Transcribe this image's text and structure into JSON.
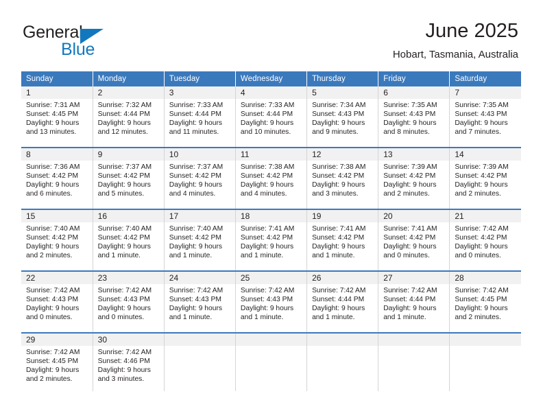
{
  "brand": {
    "name_top": "General",
    "name_bottom": "Blue",
    "triangle_color": "#1278be",
    "text_color": "#221f1f"
  },
  "header": {
    "title": "June 2025",
    "subtitle": "Hobart, Tasmania, Australia"
  },
  "theme": {
    "header_blue": "#3b79bd",
    "daynum_band": "#f1f1f1",
    "grid_line": "#d4d4d4",
    "text": "#231f20"
  },
  "weekdays": [
    "Sunday",
    "Monday",
    "Tuesday",
    "Wednesday",
    "Thursday",
    "Friday",
    "Saturday"
  ],
  "weeks": [
    [
      {
        "day": "1",
        "sunrise": "Sunrise: 7:31 AM",
        "sunset": "Sunset: 4:45 PM",
        "daylight_line1": "Daylight: 9 hours",
        "daylight_line2": "and 13 minutes."
      },
      {
        "day": "2",
        "sunrise": "Sunrise: 7:32 AM",
        "sunset": "Sunset: 4:44 PM",
        "daylight_line1": "Daylight: 9 hours",
        "daylight_line2": "and 12 minutes."
      },
      {
        "day": "3",
        "sunrise": "Sunrise: 7:33 AM",
        "sunset": "Sunset: 4:44 PM",
        "daylight_line1": "Daylight: 9 hours",
        "daylight_line2": "and 11 minutes."
      },
      {
        "day": "4",
        "sunrise": "Sunrise: 7:33 AM",
        "sunset": "Sunset: 4:44 PM",
        "daylight_line1": "Daylight: 9 hours",
        "daylight_line2": "and 10 minutes."
      },
      {
        "day": "5",
        "sunrise": "Sunrise: 7:34 AM",
        "sunset": "Sunset: 4:43 PM",
        "daylight_line1": "Daylight: 9 hours",
        "daylight_line2": "and 9 minutes."
      },
      {
        "day": "6",
        "sunrise": "Sunrise: 7:35 AM",
        "sunset": "Sunset: 4:43 PM",
        "daylight_line1": "Daylight: 9 hours",
        "daylight_line2": "and 8 minutes."
      },
      {
        "day": "7",
        "sunrise": "Sunrise: 7:35 AM",
        "sunset": "Sunset: 4:43 PM",
        "daylight_line1": "Daylight: 9 hours",
        "daylight_line2": "and 7 minutes."
      }
    ],
    [
      {
        "day": "8",
        "sunrise": "Sunrise: 7:36 AM",
        "sunset": "Sunset: 4:42 PM",
        "daylight_line1": "Daylight: 9 hours",
        "daylight_line2": "and 6 minutes."
      },
      {
        "day": "9",
        "sunrise": "Sunrise: 7:37 AM",
        "sunset": "Sunset: 4:42 PM",
        "daylight_line1": "Daylight: 9 hours",
        "daylight_line2": "and 5 minutes."
      },
      {
        "day": "10",
        "sunrise": "Sunrise: 7:37 AM",
        "sunset": "Sunset: 4:42 PM",
        "daylight_line1": "Daylight: 9 hours",
        "daylight_line2": "and 4 minutes."
      },
      {
        "day": "11",
        "sunrise": "Sunrise: 7:38 AM",
        "sunset": "Sunset: 4:42 PM",
        "daylight_line1": "Daylight: 9 hours",
        "daylight_line2": "and 4 minutes."
      },
      {
        "day": "12",
        "sunrise": "Sunrise: 7:38 AM",
        "sunset": "Sunset: 4:42 PM",
        "daylight_line1": "Daylight: 9 hours",
        "daylight_line2": "and 3 minutes."
      },
      {
        "day": "13",
        "sunrise": "Sunrise: 7:39 AM",
        "sunset": "Sunset: 4:42 PM",
        "daylight_line1": "Daylight: 9 hours",
        "daylight_line2": "and 2 minutes."
      },
      {
        "day": "14",
        "sunrise": "Sunrise: 7:39 AM",
        "sunset": "Sunset: 4:42 PM",
        "daylight_line1": "Daylight: 9 hours",
        "daylight_line2": "and 2 minutes."
      }
    ],
    [
      {
        "day": "15",
        "sunrise": "Sunrise: 7:40 AM",
        "sunset": "Sunset: 4:42 PM",
        "daylight_line1": "Daylight: 9 hours",
        "daylight_line2": "and 2 minutes."
      },
      {
        "day": "16",
        "sunrise": "Sunrise: 7:40 AM",
        "sunset": "Sunset: 4:42 PM",
        "daylight_line1": "Daylight: 9 hours",
        "daylight_line2": "and 1 minute."
      },
      {
        "day": "17",
        "sunrise": "Sunrise: 7:40 AM",
        "sunset": "Sunset: 4:42 PM",
        "daylight_line1": "Daylight: 9 hours",
        "daylight_line2": "and 1 minute."
      },
      {
        "day": "18",
        "sunrise": "Sunrise: 7:41 AM",
        "sunset": "Sunset: 4:42 PM",
        "daylight_line1": "Daylight: 9 hours",
        "daylight_line2": "and 1 minute."
      },
      {
        "day": "19",
        "sunrise": "Sunrise: 7:41 AM",
        "sunset": "Sunset: 4:42 PM",
        "daylight_line1": "Daylight: 9 hours",
        "daylight_line2": "and 1 minute."
      },
      {
        "day": "20",
        "sunrise": "Sunrise: 7:41 AM",
        "sunset": "Sunset: 4:42 PM",
        "daylight_line1": "Daylight: 9 hours",
        "daylight_line2": "and 0 minutes."
      },
      {
        "day": "21",
        "sunrise": "Sunrise: 7:42 AM",
        "sunset": "Sunset: 4:42 PM",
        "daylight_line1": "Daylight: 9 hours",
        "daylight_line2": "and 0 minutes."
      }
    ],
    [
      {
        "day": "22",
        "sunrise": "Sunrise: 7:42 AM",
        "sunset": "Sunset: 4:43 PM",
        "daylight_line1": "Daylight: 9 hours",
        "daylight_line2": "and 0 minutes."
      },
      {
        "day": "23",
        "sunrise": "Sunrise: 7:42 AM",
        "sunset": "Sunset: 4:43 PM",
        "daylight_line1": "Daylight: 9 hours",
        "daylight_line2": "and 0 minutes."
      },
      {
        "day": "24",
        "sunrise": "Sunrise: 7:42 AM",
        "sunset": "Sunset: 4:43 PM",
        "daylight_line1": "Daylight: 9 hours",
        "daylight_line2": "and 1 minute."
      },
      {
        "day": "25",
        "sunrise": "Sunrise: 7:42 AM",
        "sunset": "Sunset: 4:43 PM",
        "daylight_line1": "Daylight: 9 hours",
        "daylight_line2": "and 1 minute."
      },
      {
        "day": "26",
        "sunrise": "Sunrise: 7:42 AM",
        "sunset": "Sunset: 4:44 PM",
        "daylight_line1": "Daylight: 9 hours",
        "daylight_line2": "and 1 minute."
      },
      {
        "day": "27",
        "sunrise": "Sunrise: 7:42 AM",
        "sunset": "Sunset: 4:44 PM",
        "daylight_line1": "Daylight: 9 hours",
        "daylight_line2": "and 1 minute."
      },
      {
        "day": "28",
        "sunrise": "Sunrise: 7:42 AM",
        "sunset": "Sunset: 4:45 PM",
        "daylight_line1": "Daylight: 9 hours",
        "daylight_line2": "and 2 minutes."
      }
    ],
    [
      {
        "day": "29",
        "sunrise": "Sunrise: 7:42 AM",
        "sunset": "Sunset: 4:45 PM",
        "daylight_line1": "Daylight: 9 hours",
        "daylight_line2": "and 2 minutes."
      },
      {
        "day": "30",
        "sunrise": "Sunrise: 7:42 AM",
        "sunset": "Sunset: 4:46 PM",
        "daylight_line1": "Daylight: 9 hours",
        "daylight_line2": "and 3 minutes."
      },
      {
        "day": "",
        "sunrise": "",
        "sunset": "",
        "daylight_line1": "",
        "daylight_line2": ""
      },
      {
        "day": "",
        "sunrise": "",
        "sunset": "",
        "daylight_line1": "",
        "daylight_line2": ""
      },
      {
        "day": "",
        "sunrise": "",
        "sunset": "",
        "daylight_line1": "",
        "daylight_line2": ""
      },
      {
        "day": "",
        "sunrise": "",
        "sunset": "",
        "daylight_line1": "",
        "daylight_line2": ""
      },
      {
        "day": "",
        "sunrise": "",
        "sunset": "",
        "daylight_line1": "",
        "daylight_line2": ""
      }
    ]
  ]
}
